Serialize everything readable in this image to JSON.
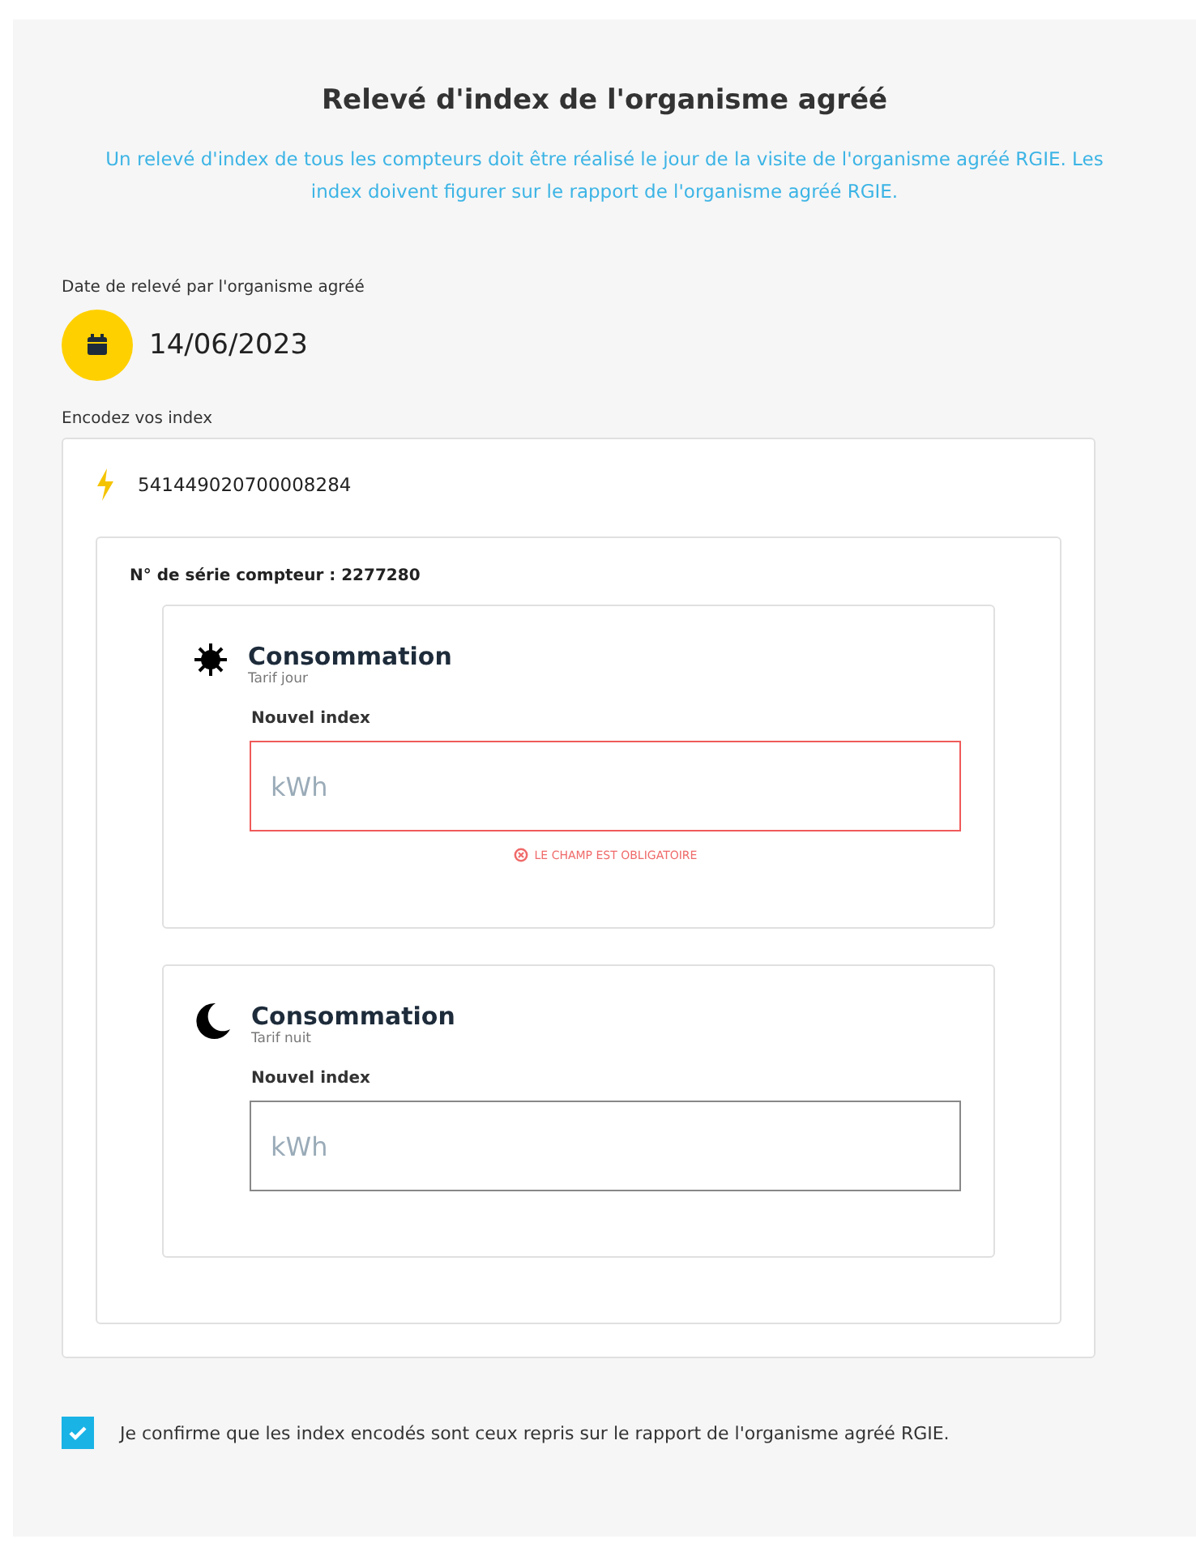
{
  "title": "Relevé d'index de l'organisme agréé",
  "intro": "Un relevé d'index de tous les compteurs doit être réalisé le jour de la visite de l'organisme agréé RGIE. Les index doivent figurer sur le rapport de l'organisme agréé RGIE.",
  "date": {
    "label": "Date de relevé par l'organisme agréé",
    "value": "14/06/2023"
  },
  "index_label": "Encodez vos index",
  "meter": {
    "ean": "541449020700008284",
    "serial": "N° de série compteur : 2277280",
    "registers": [
      {
        "kind": "day",
        "title": "Consommation",
        "subtitle": "Tarif jour",
        "field_label": "Nouvel index",
        "placeholder": "kWh",
        "invalid": true,
        "error": "LE CHAMP EST OBLIGATOIRE"
      },
      {
        "kind": "night",
        "title": "Consommation",
        "subtitle": "Tarif nuit",
        "field_label": "Nouvel index",
        "placeholder": "kWh",
        "invalid": false
      }
    ]
  },
  "confirm": {
    "label": "Je confirme que les index encodés sont ceux repris sur le rapport de l'organisme agréé RGIE.",
    "checked": true
  }
}
